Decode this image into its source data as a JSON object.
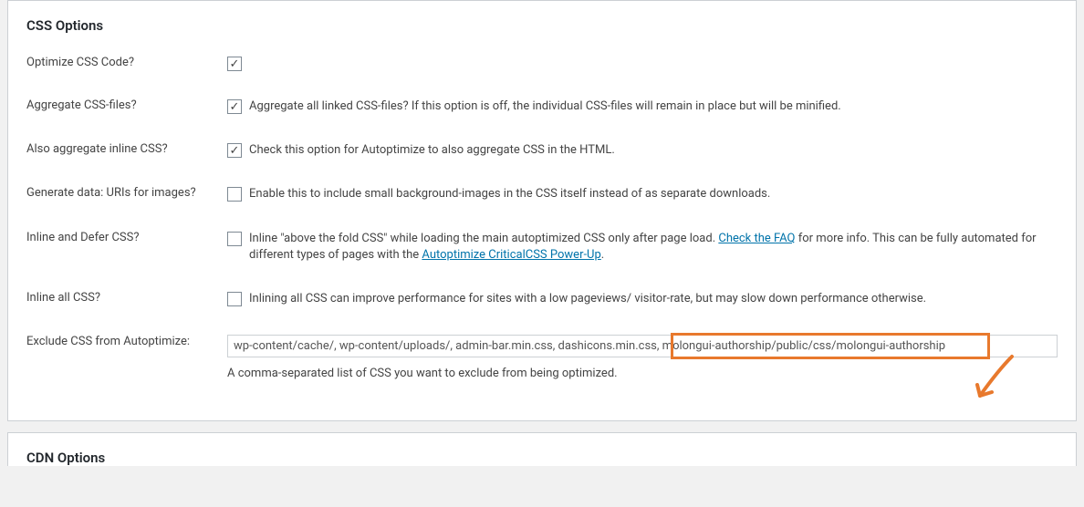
{
  "section": {
    "title": "CSS Options"
  },
  "options": {
    "optimize_css": {
      "label": "Optimize CSS Code?",
      "checked": true,
      "desc": ""
    },
    "aggregate_css": {
      "label": "Aggregate CSS-files?",
      "checked": true,
      "desc": "Aggregate all linked CSS-files? If this option is off, the individual CSS-files will remain in place but will be minified."
    },
    "aggregate_inline": {
      "label": "Also aggregate inline CSS?",
      "checked": true,
      "desc": "Check this option for Autoptimize to also aggregate CSS in the HTML."
    },
    "data_uris": {
      "label": "Generate data: URIs for images?",
      "checked": false,
      "desc": "Enable this to include small background-images in the CSS itself instead of as separate downloads."
    },
    "inline_defer": {
      "label": "Inline and Defer CSS?",
      "checked": false,
      "desc_pre": "Inline \"above the fold CSS\" while loading the main autoptimized CSS only after page load. ",
      "link1": "Check the FAQ",
      "desc_mid": " for more info. This can be fully automated for different types of pages with the ",
      "link2": "Autoptimize CriticalCSS Power-Up",
      "desc_post": "."
    },
    "inline_all": {
      "label": "Inline all CSS?",
      "checked": false,
      "desc": "Inlining all CSS can improve performance for sites with a low pageviews/ visitor-rate, but may slow down performance otherwise."
    },
    "exclude": {
      "label": "Exclude CSS from Autoptimize:",
      "value": "wp-content/cache/, wp-content/uploads/, admin-bar.min.css, dashicons.min.css, molongui-authorship/public/css/molongui-authorship",
      "hint": "A comma-separated list of CSS you want to exclude from being optimized."
    }
  },
  "next_section": {
    "title": "CDN Options"
  }
}
